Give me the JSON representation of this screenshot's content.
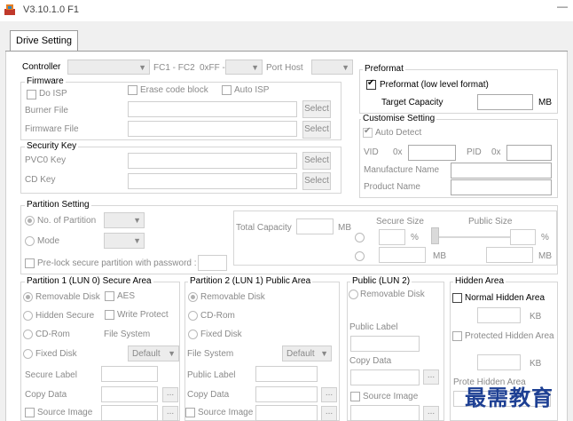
{
  "window": {
    "title": "V3.10.1.0 F1",
    "minimize_glyph": "—"
  },
  "tabs": [
    {
      "label": "Drive Setting"
    }
  ],
  "controller": {
    "label": "Controller",
    "fc_text": "FC1 - FC2",
    "hex_text": "0xFF -",
    "port_label": "Port Host"
  },
  "firmware": {
    "title": "Firmware",
    "do_isp": "Do ISP",
    "erase_code_block": "Erase code block",
    "auto_isp": "Auto ISP",
    "burner_file": "Burner File",
    "firmware_file": "Firmware File",
    "select": "Select"
  },
  "security_key": {
    "title": "Security Key",
    "pvc0_key": "PVC0 Key",
    "cd_key": "CD Key",
    "select": "Select"
  },
  "preformat": {
    "title": "Preformat",
    "checkbox_label": "Preformat (low level format)",
    "checked": true,
    "target_capacity": "Target Capacity",
    "unit": "MB"
  },
  "customise": {
    "title": "Customise Setting",
    "auto_detect": "Auto Detect",
    "auto_detect_checked": true,
    "vid": "VID",
    "pid": "PID",
    "hex_prefix": "0x",
    "manufacture_name": "Manufacture Name",
    "product_name": "Product Name"
  },
  "partition": {
    "title": "Partition Setting",
    "no_of_partition": "No. of Partition",
    "mode": "Mode",
    "prelock": "Pre-lock secure partition with password :",
    "total_capacity": "Total Capacity",
    "mb": "MB",
    "secure_size": "Secure Size",
    "public_size": "Public Size",
    "percent": "%"
  },
  "lun0": {
    "title": "Partition 1 (LUN 0) Secure Area",
    "removable_disk": "Removable Disk",
    "aes": "AES",
    "hidden_secure": "Hidden Secure",
    "write_protect": "Write Protect",
    "cd_rom": "CD-Rom",
    "file_system": "File System",
    "fixed_disk": "Fixed Disk",
    "default": "Default",
    "secure_label": "Secure Label",
    "copy_data": "Copy Data",
    "source_image": "Source Image",
    "browse": "..."
  },
  "lun1": {
    "title": "Partition 2 (LUN 1) Public Area",
    "removable_disk": "Removable Disk",
    "cd_rom": "CD-Rom",
    "fixed_disk": "Fixed Disk",
    "file_system": "File System",
    "default": "Default",
    "public_label": "Public Label",
    "copy_data": "Copy Data",
    "source_image": "Source Image",
    "browse": "..."
  },
  "public_lun2": {
    "title": "Public (LUN 2)",
    "removable_disk": "Removable Disk",
    "public_label": "Public Label",
    "copy_data": "Copy Data",
    "source_image": "Source Image",
    "browse": "..."
  },
  "hidden_area": {
    "title": "Hidden Area",
    "normal_hidden_area": "Normal Hidden Area",
    "kb": "KB",
    "protected_hidden_area": "Protected Hidden Area",
    "truncated_label": "Prote  Hidden  Area"
  },
  "watermark": {
    "text": "最需教育"
  }
}
